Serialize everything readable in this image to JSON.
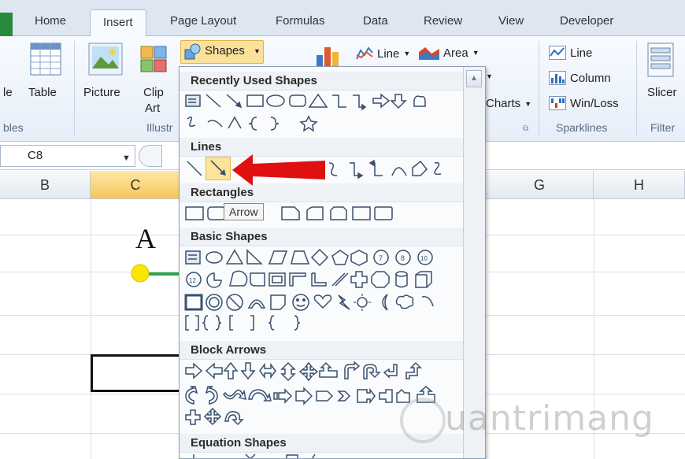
{
  "tabs": [
    "Home",
    "Insert",
    "Page Layout",
    "Formulas",
    "Data",
    "Review",
    "View",
    "Developer"
  ],
  "ribbon": {
    "table_label_partial": "le",
    "table_label": "Table",
    "tables_group_partial": "bles",
    "picture_label": "Picture",
    "clipart_label1": "Clip",
    "clipart_label2": "Art",
    "illus_group_partial": "Illustr",
    "shapes_label": "Shapes",
    "line_chart_label": "Line",
    "area_chart_label": "Area",
    "charts_partial": "Charts",
    "spark_line_label": "Line",
    "spark_column_label": "Column",
    "spark_winloss_label": "Win/Loss",
    "sparklines_group_label": "Sparklines",
    "slicer_label": "Slicer",
    "filter_group_label": "Filter"
  },
  "namebox": "C8",
  "columns": [
    "B",
    "C",
    "G",
    "H"
  ],
  "cell_text": "A",
  "dropdown": {
    "sections": [
      "Recently Used Shapes",
      "Lines",
      "Rectangles",
      "Basic Shapes",
      "Block Arrows",
      "Equation Shapes"
    ],
    "tooltip": "Arrow"
  },
  "watermark": "uantrimang",
  "colors": {
    "accent": "#f6c65a",
    "highlight": "#fce59a",
    "red_arrow": "#e01010"
  }
}
